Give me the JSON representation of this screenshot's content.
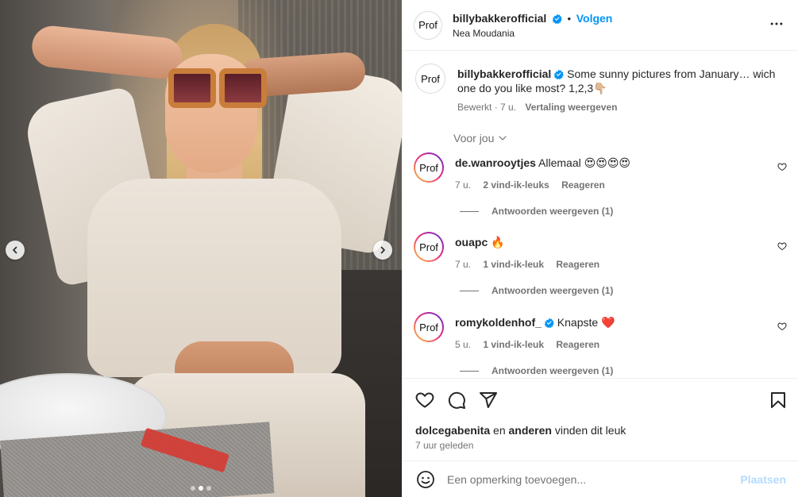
{
  "header": {
    "username": "billybakkerofficial",
    "separator": "•",
    "follow_label": "Volgen",
    "location": "Nea Moudania",
    "avatar_text": "Prof"
  },
  "caption": {
    "username": "billybakkerofficial",
    "text": "Some sunny pictures from January… wich one do you like most? 1,2,3👇🏼",
    "edited": "Bewerkt",
    "time": "7 u.",
    "translate": "Vertaling weergeven",
    "avatar_text": "Prof"
  },
  "sort": {
    "label": "Voor jou"
  },
  "comments": [
    {
      "username": "de.wanrooytjes",
      "verified": false,
      "text": "Allemaal 😍😍😍😍",
      "time": "7 u.",
      "likes": "2 vind-ik-leuks",
      "reply": "Reageren",
      "view_replies": "Antwoorden weergeven (1)",
      "avatar_text": "Prof"
    },
    {
      "username": "ouapc",
      "verified": false,
      "text": "🔥",
      "time": "7 u.",
      "likes": "1 vind-ik-leuk",
      "reply": "Reageren",
      "view_replies": "Antwoorden weergeven (1)",
      "avatar_text": "Prof"
    },
    {
      "username": "romykoldenhof_",
      "verified": true,
      "text": "Knapste ❤️",
      "time": "5 u.",
      "likes": "1 vind-ik-leuk",
      "reply": "Reageren",
      "view_replies": "Antwoorden weergeven (1)",
      "avatar_text": "Prof"
    }
  ],
  "likes": {
    "first_user": "dolcegabenita",
    "and_text": "en",
    "others": "anderen",
    "suffix": "vinden dit leuk"
  },
  "posted_ago": "7 uur geleden",
  "add_comment": {
    "placeholder": "Een opmerking toevoegen...",
    "post_label": "Plaatsen"
  },
  "carousel": {
    "slide_count": 3,
    "active_slide": 2
  },
  "colors": {
    "link_blue": "#0095f6",
    "verified_blue": "#0095f6",
    "muted": "#737373",
    "post_disabled": "#b3dbff"
  }
}
